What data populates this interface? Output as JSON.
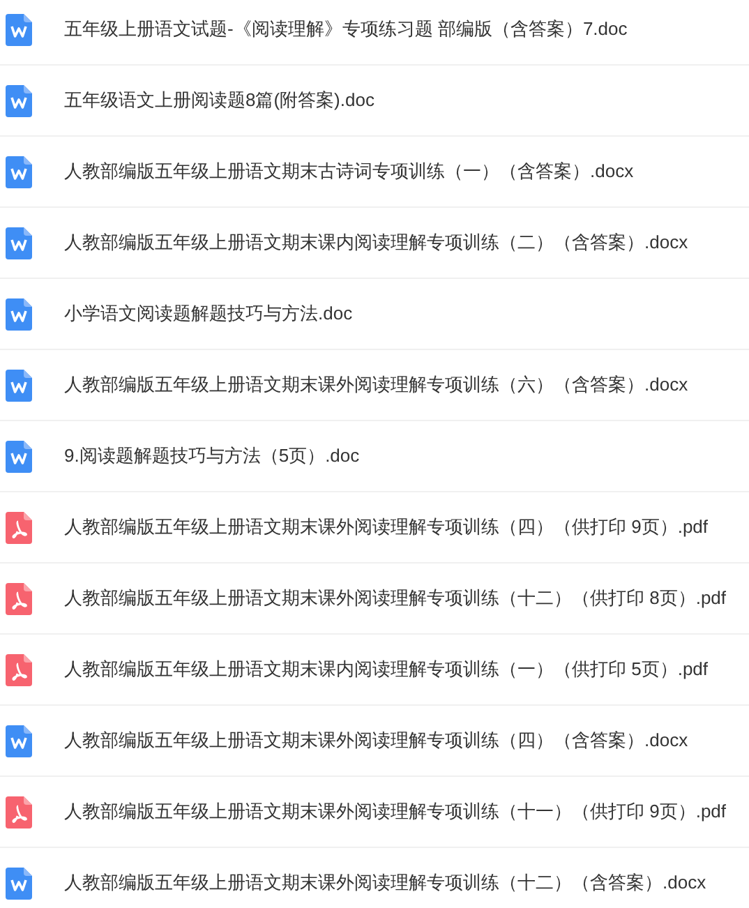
{
  "files": [
    {
      "kind": "doc",
      "name": "五年级上册语文试题-《阅读理解》专项练习题 部编版（含答案）7.doc"
    },
    {
      "kind": "doc",
      "name": "五年级语文上册阅读题8篇(附答案).doc"
    },
    {
      "kind": "doc",
      "name": "人教部编版五年级上册语文期末古诗词专项训练（一）（含答案）.docx"
    },
    {
      "kind": "doc",
      "name": "人教部编版五年级上册语文期末课内阅读理解专项训练（二）（含答案）.docx"
    },
    {
      "kind": "doc",
      "name": "小学语文阅读题解题技巧与方法.doc"
    },
    {
      "kind": "doc",
      "name": "人教部编版五年级上册语文期末课外阅读理解专项训练（六）（含答案）.docx"
    },
    {
      "kind": "doc",
      "name": "9.阅读题解题技巧与方法（5页）.doc"
    },
    {
      "kind": "pdf",
      "name": "人教部编版五年级上册语文期末课外阅读理解专项训练（四）（供打印 9页）.pdf"
    },
    {
      "kind": "pdf",
      "name": "人教部编版五年级上册语文期末课外阅读理解专项训练（十二）（供打印 8页）.pdf"
    },
    {
      "kind": "pdf",
      "name": "人教部编版五年级上册语文期末课内阅读理解专项训练（一）（供打印 5页）.pdf"
    },
    {
      "kind": "doc",
      "name": "人教部编版五年级上册语文期末课外阅读理解专项训练（四）（含答案）.docx"
    },
    {
      "kind": "pdf",
      "name": "人教部编版五年级上册语文期末课外阅读理解专项训练（十一）（供打印 9页）.pdf"
    },
    {
      "kind": "doc",
      "name": "人教部编版五年级上册语文期末课外阅读理解专项训练（十二）（含答案）.docx"
    }
  ]
}
